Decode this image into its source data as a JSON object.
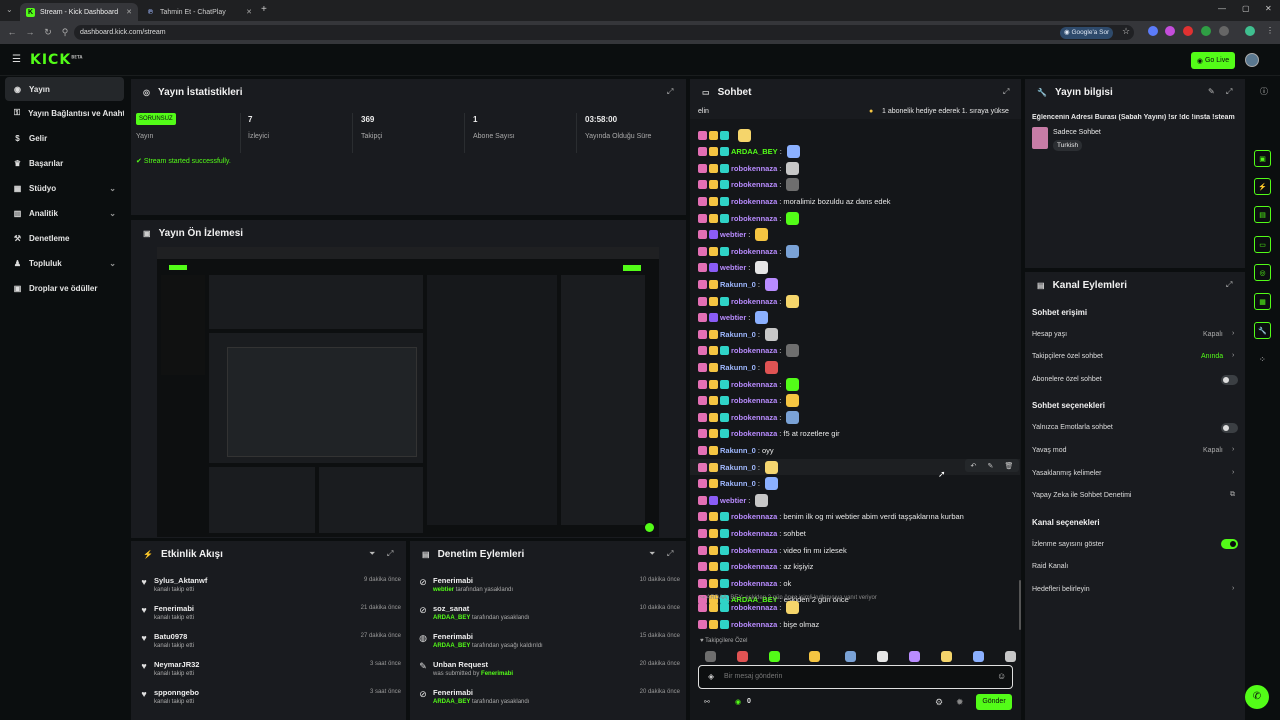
{
  "browser": {
    "tabs": [
      {
        "title": "Stream - Kick Dashboard",
        "icon": "kick-icon"
      },
      {
        "title": "Tahmin Et - ChatPlay",
        "icon": "chatplay-icon"
      }
    ],
    "url": "dashboard.kick.com/stream",
    "google_btn": "Google'a Sor"
  },
  "header": {
    "logo": "KICK",
    "logo_beta": "BETA",
    "go_live": "Go Live"
  },
  "sidebar": {
    "items": [
      {
        "label": "Yayın",
        "icon": "broadcast-icon"
      },
      {
        "label": "Yayın Bağlantısı ve Anahtarı",
        "icon": "key-icon"
      },
      {
        "label": "Gelir",
        "icon": "money-icon"
      },
      {
        "label": "Başarılar",
        "icon": "trophy-icon"
      },
      {
        "label": "Stüdyo",
        "icon": "studio-icon"
      },
      {
        "label": "Analitik",
        "icon": "analytics-icon"
      },
      {
        "label": "Denetleme",
        "icon": "moderation-icon"
      },
      {
        "label": "Topluluk",
        "icon": "community-icon"
      },
      {
        "label": "Droplar ve ödüller",
        "icon": "gift-icon"
      }
    ]
  },
  "stats": {
    "title": "Yayın İstatistikleri",
    "status_badge": "SORUNSUZ",
    "items": [
      {
        "value": "",
        "label": "Yayın"
      },
      {
        "value": "7",
        "label": "İzleyici"
      },
      {
        "value": "369",
        "label": "Takipçi"
      },
      {
        "value": "1",
        "label": "Abone Sayısı"
      },
      {
        "value": "03:58:00",
        "label": "Yayında Olduğu Süre"
      }
    ],
    "success_msg": "Stream started successfully."
  },
  "preview": {
    "title": "Yayın Ön İzlemesi"
  },
  "activity": {
    "title": "Etkinlik Akışı",
    "items": [
      {
        "name": "Sylus_Aktanwf",
        "sub": "kanalı takip etti",
        "time": "9 dakika önce"
      },
      {
        "name": "Fenerimabi",
        "sub": "kanalı takip etti",
        "time": "21 dakika önce"
      },
      {
        "name": "Batu0978",
        "sub": "kanalı takip etti",
        "time": "27 dakika önce"
      },
      {
        "name": "NeymarJR32",
        "sub": "kanalı takip etti",
        "time": "3 saat önce"
      },
      {
        "name": "spponngebo",
        "sub": "kanalı takip etti",
        "time": "3 saat önce"
      }
    ]
  },
  "modlog": {
    "title": "Denetim Eylemleri",
    "items": [
      {
        "name": "Fenerimabi",
        "actor": "webtier",
        "sub": "tarafından yasaklandı",
        "time": "10 dakika önce"
      },
      {
        "name": "soz_sanat",
        "actor": "ARDAA_BEY",
        "sub": "tarafından yasaklandı",
        "time": "10 dakika önce"
      },
      {
        "name": "Fenerimabi",
        "actor": "ARDAA_BEY",
        "sub": "tarafından yasağı kaldırıldı",
        "time": "15 dakika önce"
      },
      {
        "name": "Unban Request",
        "actor": "Fenerimabi",
        "sub": "was submitted by",
        "time": "20 dakika önce"
      },
      {
        "name": "Fenerimabi",
        "actor": "ARDAA_BEY",
        "sub": "tarafından yasaklandı",
        "time": "20 dakika önce"
      }
    ]
  },
  "chat": {
    "title": "Sohbet",
    "ticker_left": "elin",
    "ticker": "1 abonelik hediye ederek 1. sıraya yükse",
    "messages": [
      {
        "user": "",
        "text": "",
        "color": "#b98cff"
      },
      {
        "user": "ARDAA_BEY",
        "text": "",
        "color": "#53fc18"
      },
      {
        "user": "robokennaza",
        "text": "",
        "color": "#b98cff"
      },
      {
        "user": "robokennaza",
        "text": "",
        "color": "#b98cff"
      },
      {
        "user": "robokennaza",
        "text": "moralimiz bozuldu az dans edek",
        "color": "#b98cff"
      },
      {
        "user": "robokennaza",
        "text": "",
        "color": "#b98cff"
      },
      {
        "user": "webtier",
        "text": "",
        "color": "#b98cff"
      },
      {
        "user": "robokennaza",
        "text": "",
        "color": "#b98cff"
      },
      {
        "user": "webtier",
        "text": "",
        "color": "#b98cff"
      },
      {
        "user": "Rakunn_0",
        "text": "",
        "color": "#9fb8ff"
      },
      {
        "user": "robokennaza",
        "text": "",
        "color": "#b98cff"
      },
      {
        "user": "webtier",
        "text": "",
        "color": "#b98cff"
      },
      {
        "user": "Rakunn_0",
        "text": "",
        "color": "#9fb8ff"
      },
      {
        "user": "robokennaza",
        "text": "",
        "color": "#b98cff"
      },
      {
        "user": "Rakunn_0",
        "text": "",
        "color": "#9fb8ff"
      },
      {
        "user": "robokennaza",
        "text": "",
        "color": "#b98cff"
      },
      {
        "user": "robokennaza",
        "text": "",
        "color": "#b98cff"
      },
      {
        "user": "robokennaza",
        "text": "",
        "color": "#b98cff"
      },
      {
        "user": "robokennaza",
        "text": "f5 at rozetlere gir",
        "color": "#b98cff"
      },
      {
        "user": "Rakunn_0",
        "text": "oyy",
        "color": "#9fb8ff"
      },
      {
        "user": "Rakunn_0",
        "text": "",
        "color": "#9fb8ff"
      },
      {
        "user": "Rakunn_0",
        "text": "",
        "color": "#9fb8ff"
      },
      {
        "user": "webtier",
        "text": "",
        "color": "#b98cff"
      },
      {
        "user": "robokennaza",
        "text": "benim ilk og mi webtier abim verdi taşşaklarına kurban",
        "color": "#b98cff"
      },
      {
        "user": "robokennaza",
        "text": "sohbet",
        "color": "#b98cff"
      },
      {
        "user": "robokennaza",
        "text": "video fin mı izlesek",
        "color": "#b98cff"
      },
      {
        "user": "robokennaza",
        "text": "az kişiyiz",
        "color": "#b98cff"
      },
      {
        "user": "robokennaza",
        "text": "ok",
        "color": "#b98cff"
      },
      {
        "user": "ARDAA_BEY",
        "text": "eskiden 2 gün önce",
        "color": "#53fc18"
      }
    ],
    "reply_note": "↪ ARDAA_BEY: eskiden 2 gün önce isimli kullanıcıya yanıt veriyor",
    "after_reply": [
      {
        "user": "robokennaza",
        "text": "",
        "color": "#b98cff"
      },
      {
        "user": "robokennaza",
        "text": "bişe olmaz",
        "color": "#b98cff"
      }
    ],
    "followers_only": "Takipçilere Özel",
    "input_placeholder": "Bir mesaj gönderin",
    "send": "Gönder",
    "points": "0"
  },
  "info": {
    "title": "Yayın bilgisi",
    "stream_title": "Eğlencenin Adresi Burası (Sabah Yayını) !sr !dc !insta !steam",
    "category": "Sadece Sohbet",
    "tag": "Turkish"
  },
  "actions": {
    "title": "Kanal Eylemleri",
    "chat_access": "Sohbet erişimi",
    "account_age": {
      "label": "Hesap yaşı",
      "value": "Kapalı"
    },
    "followers_chat": {
      "label": "Takipçilere özel sohbet",
      "value": "Anında"
    },
    "subs_chat": {
      "label": "Abonelere özel sohbet"
    },
    "chat_options": "Sohbet seçenekleri",
    "emote_only": {
      "label": "Yalnızca Emotlarla sohbet"
    },
    "slow_mode": {
      "label": "Yavaş mod",
      "value": "Kapalı"
    },
    "banned_words": {
      "label": "Yasaklanmış kelimeler"
    },
    "ai_mod": {
      "label": "Yapay Zeka ile Sohbet Denetimi"
    },
    "channel_options": "Kanal seçenekleri",
    "show_viewers": {
      "label": "İzlenme sayısını göster"
    },
    "raid": {
      "label": "Raid Kanalı"
    },
    "targets": {
      "label": "Hedefleri belirleyin"
    }
  },
  "colors": {
    "accent": "#53fc18",
    "panel": "#191b1f",
    "bg": "#0b0e0f"
  }
}
